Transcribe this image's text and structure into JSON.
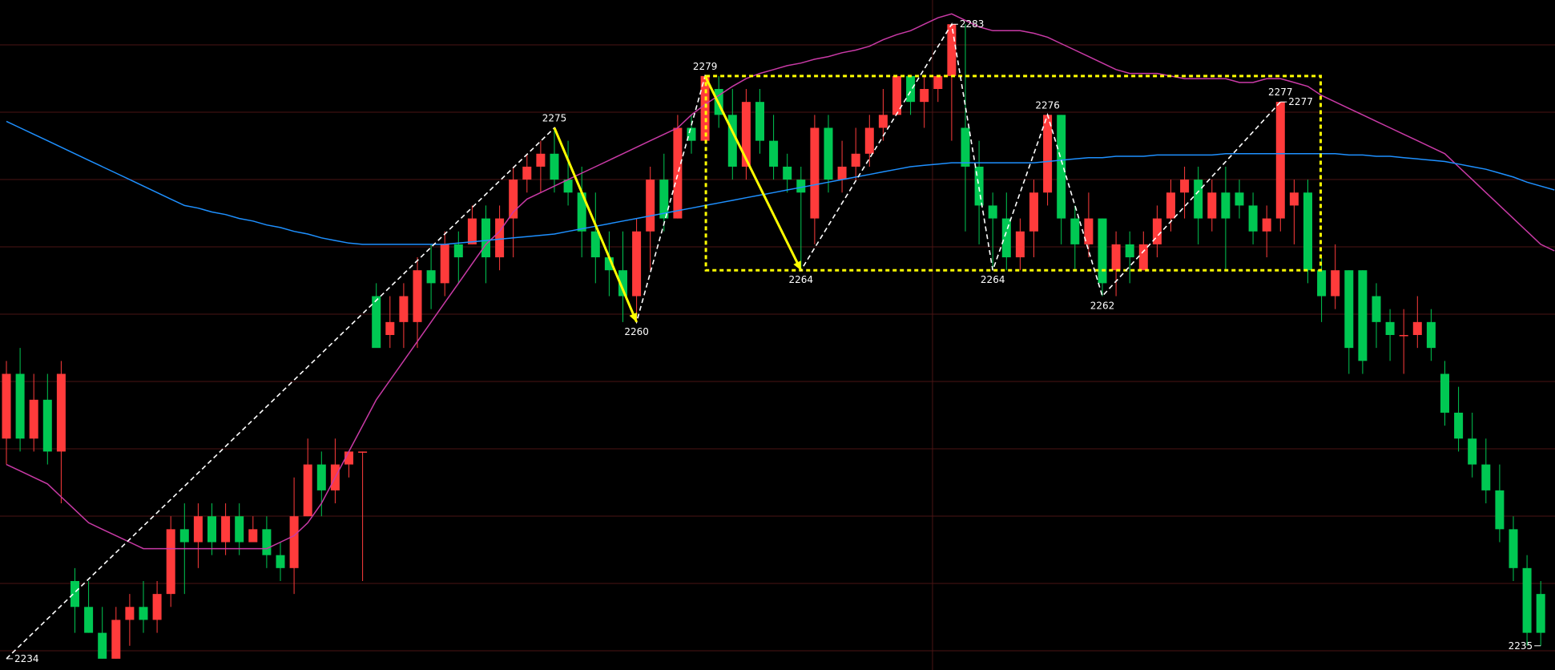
{
  "colors": {
    "background": "#000000",
    "grid": "#4a1414",
    "up": "#ff3b3b",
    "down": "#00c853",
    "ma_short": "#c93aa6",
    "ma_long": "#1e90ff",
    "annotation_yellow": "#ffff00",
    "annotation_white": "#ffffff"
  },
  "chart_data": {
    "type": "candlestick",
    "ylim": [
      2233.5,
      2284.5
    ],
    "grid": "horizontal",
    "markers": [
      {
        "label": "2234",
        "index": 0,
        "price": 2234,
        "style": "arrow-label"
      },
      {
        "label": "2275",
        "index": 40,
        "price": 2275
      },
      {
        "label": "2260",
        "index": 46,
        "price": 2260
      },
      {
        "label": "2279",
        "index": 51,
        "price": 2279
      },
      {
        "label": "2264",
        "index": 58,
        "price": 2264
      },
      {
        "label": "2283",
        "index": 69,
        "price": 2283,
        "style": "arrow-label"
      },
      {
        "label": "2264",
        "index": 72,
        "price": 2264
      },
      {
        "label": "2276",
        "index": 76,
        "price": 2276
      },
      {
        "label": "2262",
        "index": 80,
        "price": 2262
      },
      {
        "label": "2277",
        "index": 93,
        "price": 2277
      },
      {
        "label": "2277",
        "index": 93,
        "price": 2277,
        "style": "arrow-label"
      },
      {
        "label": "2235",
        "index": 112,
        "price": 2235,
        "style": "arrow-label"
      }
    ],
    "box": {
      "from_index": 51,
      "to_index": 95,
      "top": 2279,
      "bottom": 2264
    },
    "white_zigzag": [
      [
        0,
        2234
      ],
      [
        40,
        2275
      ],
      [
        46,
        2260
      ],
      [
        51,
        2279
      ],
      [
        58,
        2264
      ],
      [
        69,
        2283
      ],
      [
        72,
        2264
      ],
      [
        76,
        2276
      ],
      [
        80,
        2262
      ],
      [
        93,
        2277
      ]
    ],
    "yellow_arrows": [
      {
        "from": [
          40,
          2275
        ],
        "to": [
          46,
          2260
        ]
      },
      {
        "from": [
          51,
          2279
        ],
        "to": [
          58,
          2264
        ]
      }
    ],
    "ma_short": [
      2249,
      2248.5,
      2248,
      2247.5,
      2246.5,
      2245.5,
      2244.5,
      2244,
      2243.5,
      2243,
      2242.5,
      2242.5,
      2242.5,
      2242.5,
      2242.5,
      2242.5,
      2242.5,
      2242.5,
      2242.5,
      2242.5,
      2243,
      2243.5,
      2244.5,
      2246,
      2248,
      2250,
      2252,
      2254,
      2255.5,
      2257,
      2258.5,
      2260,
      2261.5,
      2263,
      2264.5,
      2266,
      2267,
      2268.5,
      2269.5,
      2270,
      2270.5,
      2271,
      2271.5,
      2272,
      2272.5,
      2273,
      2273.5,
      2274,
      2274.5,
      2275,
      2276,
      2276.8,
      2277.5,
      2278.2,
      2278.8,
      2279.2,
      2279.5,
      2279.8,
      2280,
      2280.3,
      2280.5,
      2280.8,
      2281,
      2281.3,
      2281.8,
      2282.2,
      2282.5,
      2283,
      2283.5,
      2283.8,
      2283.3,
      2282.8,
      2282.5,
      2282.5,
      2282.5,
      2282.3,
      2282,
      2281.5,
      2281,
      2280.5,
      2280,
      2279.5,
      2279.2,
      2279.2,
      2279.2,
      2279,
      2278.8,
      2278.8,
      2278.8,
      2278.8,
      2278.5,
      2278.5,
      2278.8,
      2278.8,
      2278.5,
      2278.2,
      2277.5,
      2277,
      2276.5,
      2276,
      2275.5,
      2275,
      2274.5,
      2274,
      2273.5,
      2273,
      2272,
      2271,
      2270,
      2269,
      2268,
      2267,
      2266,
      2265.5
    ],
    "ma_long": [
      2275.5,
      2275,
      2274.5,
      2274,
      2273.5,
      2273,
      2272.5,
      2272,
      2271.5,
      2271,
      2270.5,
      2270,
      2269.5,
      2269,
      2268.8,
      2268.5,
      2268.3,
      2268,
      2267.8,
      2267.5,
      2267.3,
      2267,
      2266.8,
      2266.5,
      2266.3,
      2266.1,
      2266,
      2266,
      2266,
      2266,
      2266,
      2266,
      2266,
      2266.1,
      2266.2,
      2266.3,
      2266.4,
      2266.5,
      2266.6,
      2266.7,
      2266.8,
      2267,
      2267.2,
      2267.4,
      2267.6,
      2267.8,
      2268,
      2268.2,
      2268.4,
      2268.6,
      2268.8,
      2269,
      2269.2,
      2269.4,
      2269.6,
      2269.8,
      2270,
      2270.2,
      2270.4,
      2270.6,
      2270.8,
      2271,
      2271.2,
      2271.4,
      2271.6,
      2271.8,
      2272,
      2272.1,
      2272.2,
      2272.3,
      2272.3,
      2272.3,
      2272.3,
      2272.3,
      2272.3,
      2272.3,
      2272.4,
      2272.5,
      2272.6,
      2272.7,
      2272.7,
      2272.8,
      2272.8,
      2272.8,
      2272.9,
      2272.9,
      2272.9,
      2272.9,
      2272.9,
      2273,
      2273,
      2273,
      2273,
      2273,
      2273,
      2273,
      2273,
      2273,
      2272.9,
      2272.9,
      2272.8,
      2272.8,
      2272.7,
      2272.6,
      2272.5,
      2272.4,
      2272.2,
      2272,
      2271.8,
      2271.5,
      2271.2,
      2270.8,
      2270.5,
      2270.2
    ],
    "candles": [
      [
        2251,
        2256,
        2249,
        2257
      ],
      [
        2256,
        2251,
        2250,
        2258
      ],
      [
        2251,
        2254,
        2250,
        2256
      ],
      [
        2254,
        2250,
        2249,
        2256
      ],
      [
        2250,
        2256,
        2246,
        2257
      ],
      [
        2240,
        2238,
        2236,
        2241
      ],
      [
        2238,
        2236,
        2236,
        2240
      ],
      [
        2236,
        2234,
        2234,
        2238
      ],
      [
        2234,
        2237,
        2234,
        2238
      ],
      [
        2237,
        2238,
        2235,
        2239
      ],
      [
        2238,
        2237,
        2236,
        2240
      ],
      [
        2237,
        2239,
        2236,
        2240
      ],
      [
        2239,
        2244,
        2238,
        2245
      ],
      [
        2244,
        2243,
        2239,
        2246
      ],
      [
        2243,
        2245,
        2241,
        2246
      ],
      [
        2245,
        2243,
        2242,
        2246
      ],
      [
        2243,
        2245,
        2242,
        2246
      ],
      [
        2245,
        2243,
        2242,
        2246
      ],
      [
        2243,
        2244,
        2243,
        2245
      ],
      [
        2244,
        2242,
        2241,
        2245
      ],
      [
        2242,
        2241,
        2240,
        2243
      ],
      [
        2241,
        2245,
        2239,
        2248
      ],
      [
        2245,
        2249,
        2245,
        2251
      ],
      [
        2249,
        2247,
        2245,
        2250
      ],
      [
        2247,
        2249,
        2246,
        2251
      ],
      [
        2249,
        2250,
        2248,
        2250
      ],
      [
        2250,
        2250,
        2240,
        2250
      ],
      [
        2262,
        2258,
        2259,
        2263
      ],
      [
        2259,
        2260,
        2258,
        2262
      ],
      [
        2260,
        2262,
        2258,
        2263
      ],
      [
        2260,
        2264,
        2258,
        2265
      ],
      [
        2264,
        2263,
        2261,
        2266
      ],
      [
        2263,
        2266,
        2262,
        2267
      ],
      [
        2266,
        2265,
        2263,
        2267
      ],
      [
        2266,
        2268,
        2266,
        2269
      ],
      [
        2268,
        2265,
        2263,
        2269
      ],
      [
        2265,
        2268,
        2264,
        2269
      ],
      [
        2268,
        2271,
        2265,
        2272
      ],
      [
        2271,
        2272,
        2270,
        2273
      ],
      [
        2272,
        2273,
        2270,
        2274
      ],
      [
        2273,
        2271,
        2270,
        2275
      ],
      [
        2271,
        2270,
        2269,
        2274
      ],
      [
        2270,
        2267,
        2265,
        2272
      ],
      [
        2267,
        2265,
        2263,
        2270
      ],
      [
        2265,
        2264,
        2262,
        2267
      ],
      [
        2264,
        2262,
        2260,
        2267
      ],
      [
        2262,
        2267,
        2260,
        2268
      ],
      [
        2267,
        2271,
        2264,
        2272
      ],
      [
        2271,
        2268,
        2267,
        2273
      ],
      [
        2268,
        2275,
        2268,
        2276
      ],
      [
        2275,
        2274,
        2273,
        2276
      ],
      [
        2274,
        2279,
        2274,
        2279
      ],
      [
        2278,
        2276,
        2275,
        2279
      ],
      [
        2276,
        2272,
        2271,
        2278
      ],
      [
        2272,
        2277,
        2271,
        2278
      ],
      [
        2277,
        2274,
        2273,
        2278
      ],
      [
        2274,
        2272,
        2271,
        2276
      ],
      [
        2272,
        2271,
        2270,
        2273
      ],
      [
        2271,
        2270,
        2264,
        2272
      ],
      [
        2268,
        2275,
        2266,
        2276
      ],
      [
        2275,
        2271,
        2270,
        2276
      ],
      [
        2271,
        2272,
        2270,
        2274
      ],
      [
        2272,
        2273,
        2271,
        2275
      ],
      [
        2273,
        2275,
        2272,
        2276
      ],
      [
        2275,
        2276,
        2274,
        2278
      ],
      [
        2276,
        2279,
        2276,
        2279
      ],
      [
        2279,
        2277,
        2276,
        2279
      ],
      [
        2277,
        2278,
        2275,
        2279
      ],
      [
        2278,
        2279,
        2277,
        2279
      ],
      [
        2279,
        2283,
        2274,
        2283
      ],
      [
        2275,
        2272,
        2267,
        2283
      ],
      [
        2272,
        2269,
        2266,
        2274
      ],
      [
        2269,
        2268,
        2264,
        2270
      ],
      [
        2268,
        2265,
        2264,
        2270
      ],
      [
        2265,
        2267,
        2264,
        2268
      ],
      [
        2267,
        2270,
        2265,
        2271
      ],
      [
        2270,
        2276,
        2269,
        2276
      ],
      [
        2276,
        2268,
        2266,
        2276
      ],
      [
        2268,
        2266,
        2264,
        2269
      ],
      [
        2266,
        2268,
        2265,
        2270
      ],
      [
        2268,
        2263,
        2262,
        2268
      ],
      [
        2264,
        2266,
        2262,
        2267
      ],
      [
        2266,
        2265,
        2263,
        2267
      ],
      [
        2264,
        2266,
        2264,
        2267
      ],
      [
        2266,
        2268,
        2265,
        2269
      ],
      [
        2268,
        2270,
        2267,
        2271
      ],
      [
        2270,
        2271,
        2268,
        2272
      ],
      [
        2271,
        2268,
        2266,
        2272
      ],
      [
        2268,
        2270,
        2267,
        2271
      ],
      [
        2270,
        2268,
        2264,
        2272
      ],
      [
        2270,
        2269,
        2268,
        2271
      ],
      [
        2269,
        2267,
        2266,
        2270
      ],
      [
        2267,
        2268,
        2265,
        2269
      ],
      [
        2268,
        2277,
        2267,
        2277
      ],
      [
        2269,
        2270,
        2266,
        2271
      ],
      [
        2270,
        2264,
        2263,
        2271
      ],
      [
        2264,
        2262,
        2260,
        2265
      ],
      [
        2262,
        2264,
        2261,
        2266
      ],
      [
        2264,
        2258,
        2256,
        2264
      ],
      [
        2264,
        2257,
        2256,
        2264
      ],
      [
        2262,
        2260,
        2258,
        2263
      ],
      [
        2260,
        2259,
        2257,
        2261
      ],
      [
        2259,
        2259,
        2256,
        2261
      ],
      [
        2259,
        2260,
        2258,
        2262
      ],
      [
        2260,
        2258,
        2257,
        2261
      ],
      [
        2256,
        2253,
        2252,
        2257
      ],
      [
        2253,
        2251,
        2250,
        2255
      ],
      [
        2251,
        2249,
        2248,
        2253
      ],
      [
        2249,
        2247,
        2246,
        2251
      ],
      [
        2247,
        2244,
        2243,
        2249
      ],
      [
        2244,
        2241,
        2240,
        2245
      ],
      [
        2241,
        2236,
        2235,
        2242
      ],
      [
        2239,
        2236,
        2235,
        2240
      ]
    ]
  }
}
